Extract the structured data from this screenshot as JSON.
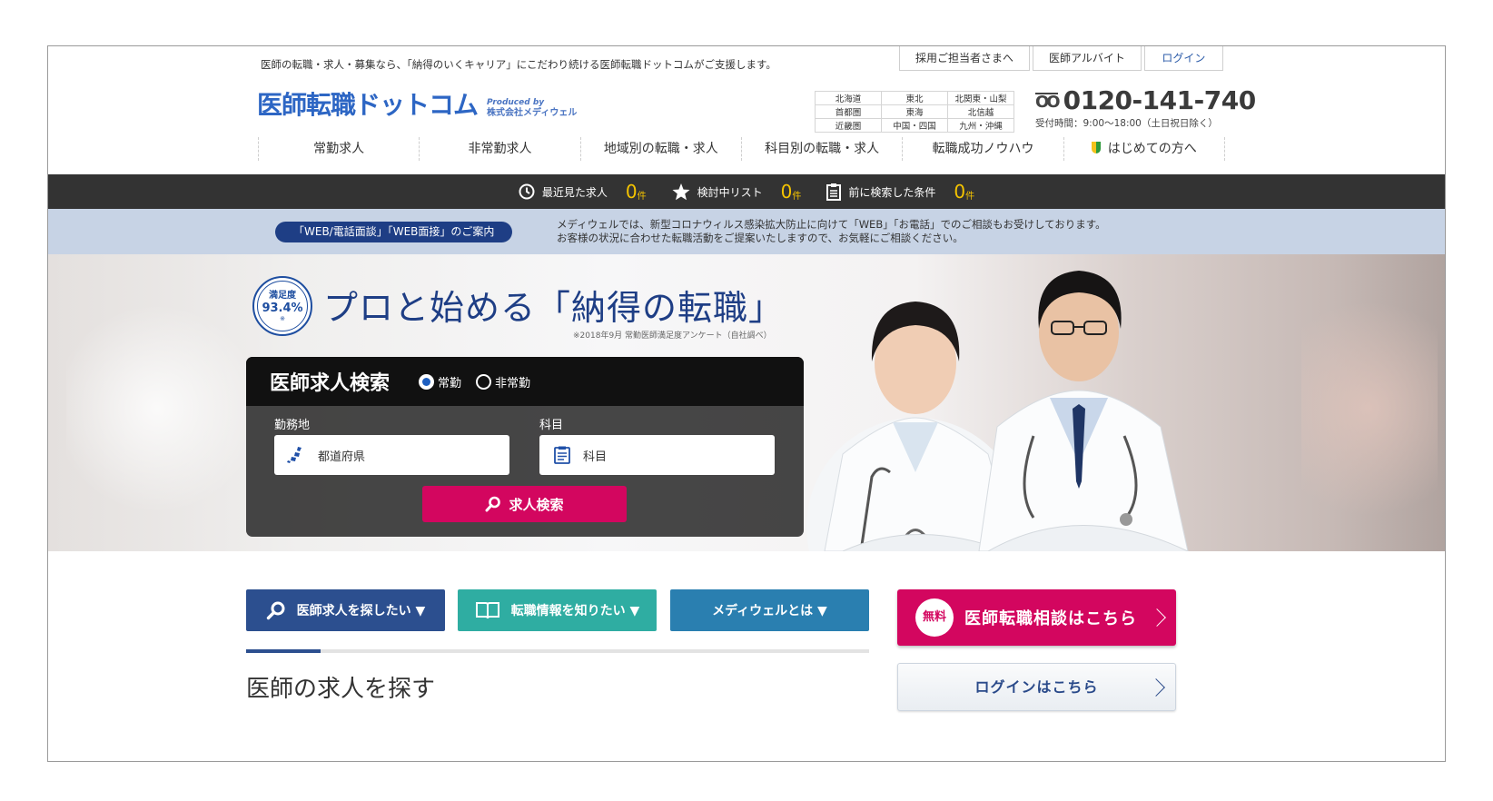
{
  "header": {
    "tagline": "医師の転職・求人・募集なら、「納得のいくキャリア」にこだわり続ける医師転職ドットコムがご支援します。",
    "top_links": [
      "採用ご担当者さまへ",
      "医師アルバイト",
      "ログイン"
    ],
    "logo_main": "医師転職ドットコム",
    "logo_produced": "Produced by",
    "logo_company": "株式会社メディウェル",
    "regions": [
      [
        "北海道",
        "東北",
        "北関東・山梨"
      ],
      [
        "首都圏",
        "東海",
        "北信越"
      ],
      [
        "近畿圏",
        "中国・四国",
        "九州・沖縄"
      ]
    ],
    "phone": "0120-141-740",
    "phone_icon": "free-dial-icon",
    "hours": "受付時間：9:00〜18:00（土日祝日除く）"
  },
  "nav": [
    "常勤求人",
    "非常勤求人",
    "地域別の転職・求人",
    "科目別の転職・求人",
    "転職成功ノウハウ",
    "はじめての方へ"
  ],
  "dark_bar": [
    {
      "label": "最近見た求人",
      "count": "0",
      "unit": "件",
      "icon": "clock-icon"
    },
    {
      "label": "検討中リスト",
      "count": "0",
      "unit": "件",
      "icon": "star-icon"
    },
    {
      "label": "前に検索した条件",
      "count": "0",
      "unit": "件",
      "icon": "list-icon"
    }
  ],
  "info": {
    "pill": "「WEB/電話面談」「WEB面接」のご案内",
    "line1": "メディウェルでは、新型コロナウィルス感染拡大防止に向けて「WEB」「お電話」でのご相談もお受けしております。",
    "line2": "お客様の状況に合わせた転職活動をご提案いたしますので、お気軽にご相談ください。"
  },
  "hero": {
    "badge_label": "満足度",
    "badge_value": "93.4%",
    "badge_mark": "※",
    "headline": "プロと始める「納得の転職」",
    "note": "※2018年9月 常勤医師満足度アンケート（自社調べ）"
  },
  "search": {
    "title": "医師求人検索",
    "radio_full": "常勤",
    "radio_part": "非常勤",
    "selected": "常勤",
    "location_label": "勤務地",
    "location_value": "都道府県",
    "subject_label": "科目",
    "subject_value": "科目",
    "button": "求人検索"
  },
  "tabs": [
    "医師求人を探したい ▼",
    "転職情報を知りたい ▼",
    "メディウェルとは ▼"
  ],
  "tab_progress": 0.12,
  "section_title": "医師の求人を探す",
  "consult": {
    "badge": "無料",
    "text": "医師転職相談はこちら"
  },
  "login_button": "ログインはこちら",
  "colors": {
    "brand_blue": "#2d66c4",
    "navy": "#1e3e85",
    "magenta": "#d3065f",
    "teal": "#2fada2"
  }
}
